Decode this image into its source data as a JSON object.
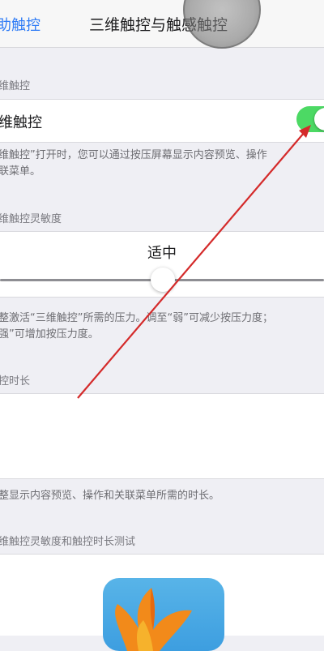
{
  "nav": {
    "back_label": "辅助触控",
    "back_visible": "助触控",
    "title": "三维触控与触感触控"
  },
  "sections": {
    "three_d_header": "维触控",
    "three_d_toggle_label": "维触控",
    "three_d_toggle_on": true,
    "three_d_footnote_line1": "维触控”打开时，您可以通过按压屏幕显示内容预览、操作",
    "three_d_footnote_line2": "联菜单。",
    "sensitivity_header": "维触控灵敏度",
    "sensitivity_value": "适中",
    "sensitivity_level_fraction": 0.5,
    "sensitivity_footnote_line1": "整激活“三维触控”所需的压力。调至“弱”可减少按压力度；",
    "sensitivity_footnote_line2": "强”可增加按压力度。",
    "duration_header": "控时长",
    "duration_footnote": "整显示内容预览、操作和关联菜单所需的时长。",
    "test_header": "维触控灵敏度和触控时长测试"
  },
  "colors": {
    "accent": "#2f7cf6",
    "toggle_on": "#4cd964",
    "arrow": "#d42a2a",
    "background": "#efeff4"
  }
}
